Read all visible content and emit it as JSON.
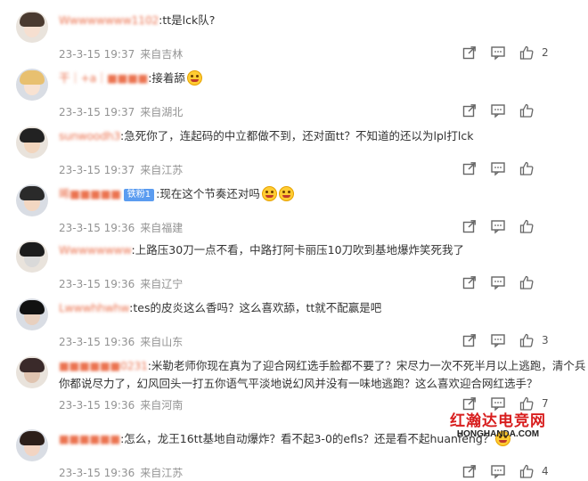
{
  "comments": [
    {
      "username": "Wwwwwwww1102",
      "text": ":tt是lck队?",
      "time": "23-3-15 19:37",
      "location": "来自吉林",
      "likes": "2",
      "emoji": false,
      "badge": ""
    },
    {
      "username": "干｜+a｜■■■■",
      "text": ":接着舔",
      "time": "23-3-15 19:37",
      "location": "来自湖北",
      "likes": "",
      "emoji": true,
      "badge": ""
    },
    {
      "username": "sunwoodh3",
      "text": ":急死你了，连起码的中立都做不到，还对面tt？不知道的还以为lpl打lck",
      "time": "23-3-15 19:37",
      "location": "来自江苏",
      "likes": "",
      "emoji": false,
      "badge": ""
    },
    {
      "username": "晞■■■■■",
      "text": ":现在这个节奏还对吗",
      "time": "23-3-15 19:36",
      "location": "来自福建",
      "likes": "",
      "emoji": true,
      "badge": "铁粉1"
    },
    {
      "username": "Wwwwwwww",
      "text": ":上路压30刀一点不看，中路打阿卡丽压10刀吹到基地爆炸笑死我了",
      "time": "23-3-15 19:36",
      "location": "来自辽宁",
      "likes": "",
      "emoji": false,
      "badge": ""
    },
    {
      "username": "Lwwwhhwhw",
      "text": ":tes的皮炎这么香吗？这么喜欢舔，tt就不配赢是吧",
      "time": "23-3-15 19:36",
      "location": "来自山东",
      "likes": "3",
      "emoji": false,
      "badge": ""
    },
    {
      "username": "■■■■■■0231",
      "text": ":米勒老师你现在真为了迎合网红选手脸都不要了？宋尽力一次不死半月以上逃跑，清个兵",
      "text2": "你都说尽力了，幻风回头一打五你语气平淡地说幻风并没有一味地逃跑？这么喜欢迎合网红选手？",
      "time": "23-3-15 19:36",
      "location": "来自河南",
      "likes": "7",
      "emoji": false,
      "badge": ""
    },
    {
      "username": "■■■■■■",
      "text": ":怎么，龙王16tt基地自动爆炸？看不起3-0的efls？还是看不起huanfeng？",
      "time": "23-3-15 19:36",
      "location": "来自江苏",
      "likes": "4",
      "emoji": true,
      "badge": ""
    }
  ],
  "watermark": {
    "cn": "红瀚达电竞网",
    "en": "HONGHANDA.COM"
  },
  "icons": {
    "share": "share-icon",
    "comment": "comment-icon",
    "like": "thumbs-up-icon"
  }
}
